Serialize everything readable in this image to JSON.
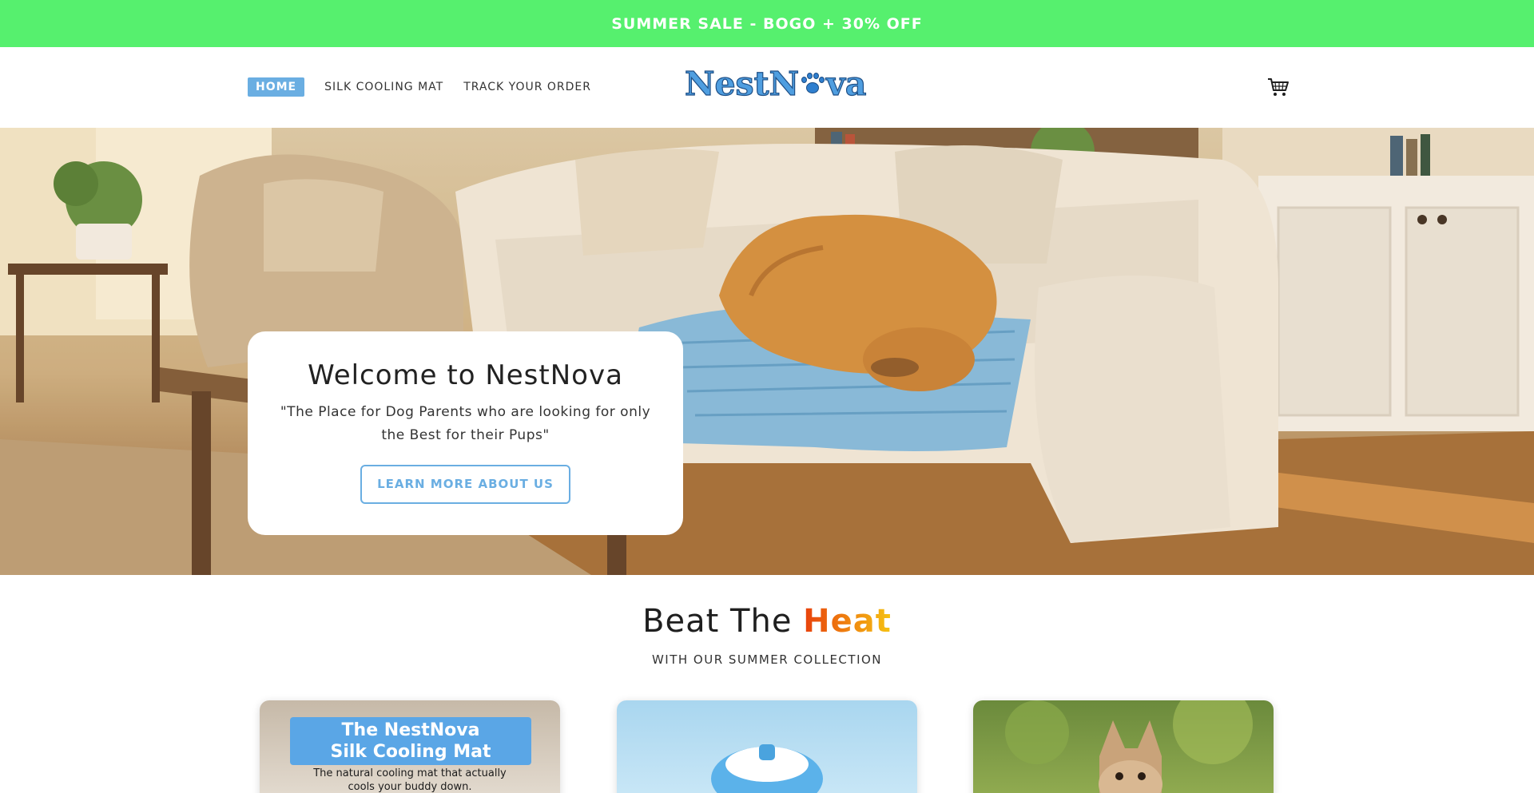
{
  "announcement": {
    "text": "SUMMER SALE - BOGO + 30% OFF"
  },
  "header": {
    "nav": [
      {
        "label": "HOME",
        "active": true
      },
      {
        "label": "SILK COOLING MAT",
        "active": false
      },
      {
        "label": "TRACK YOUR ORDER",
        "active": false
      }
    ],
    "logo_text_left": "NestN",
    "logo_text_right": "va",
    "cart_icon": "cart-icon"
  },
  "hero": {
    "title": "Welcome to NestNova",
    "tagline": "\"The Place for Dog Parents who are looking for only the Best for their Pups\"",
    "button_label": "LEARN MORE ABOUT US"
  },
  "section": {
    "title_prefix": "Beat The ",
    "title_highlight": "Heat",
    "subtitle": "WITH OUR SUMMER COLLECTION"
  },
  "products": [
    {
      "banner_line1": "The NestNova",
      "banner_line2": "Silk Cooling Mat",
      "caption_line1": "The natural cooling mat that actually",
      "caption_line2": "cools your buddy down."
    }
  ],
  "colors": {
    "announcement_bg": "#56f06e",
    "accent": "#6aaee2",
    "logo": "#4f9ee0",
    "heat_gradient_start": "#e8400c",
    "heat_gradient_end": "#f6c313"
  }
}
